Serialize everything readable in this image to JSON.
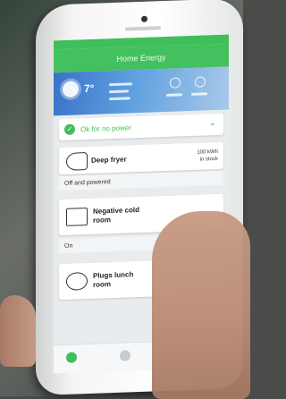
{
  "app": {
    "title": "Home Energy"
  },
  "weather": {
    "temperature": "7°"
  },
  "cards": [
    {
      "label": "Ok for no power",
      "icon": "check-icon"
    },
    {
      "label": "Deep fryer",
      "icon": "fryer-icon",
      "usage": "100 kWh",
      "usage_sub": "in stock",
      "status": "Off and powered"
    },
    {
      "label": "Negative cold room",
      "icon": "cold-room-icon",
      "status": "On"
    },
    {
      "label": "Plugs lunch room",
      "icon": "plug-icon"
    }
  ]
}
